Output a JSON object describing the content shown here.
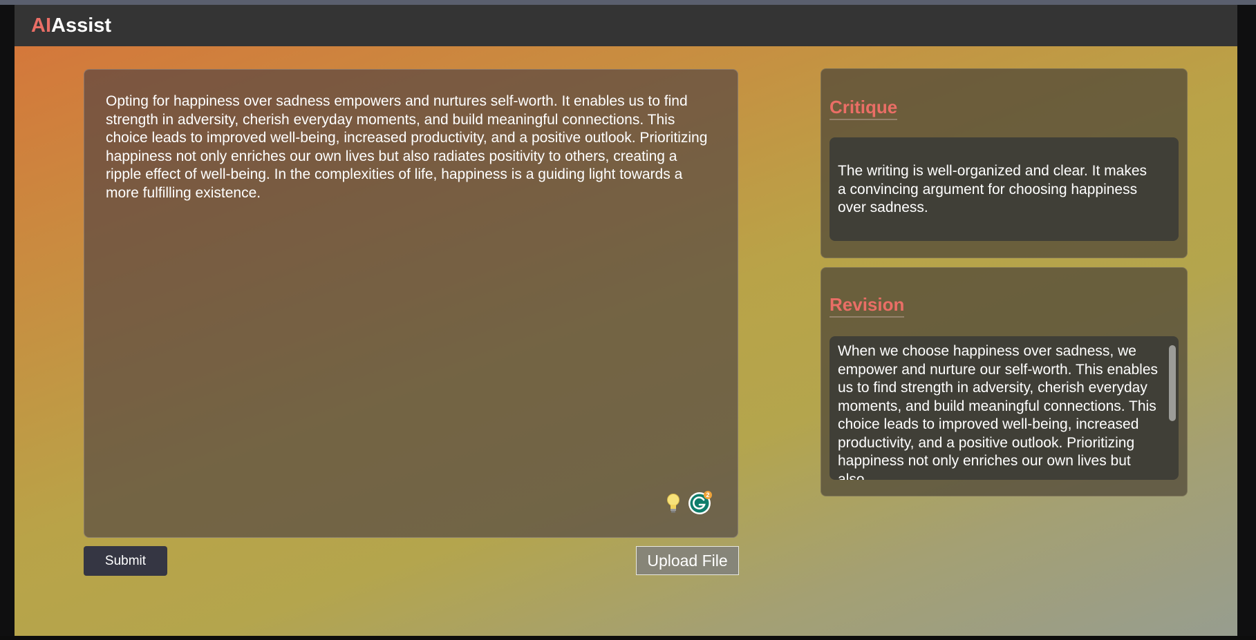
{
  "app": {
    "brand_prefix": "AI",
    "brand_suffix": "Assist",
    "colors": {
      "accent": "#ea6e66",
      "navbar": "#343434",
      "submit_button": "#353643"
    }
  },
  "editor": {
    "text": "Opting for happiness over sadness empowers and nurtures self-worth. It enables us to find strength in adversity, cherish everyday moments, and build meaningful connections. This choice leads to improved well-being, increased productivity, and a positive outlook. Prioritizing happiness not only enriches our own lives but also radiates positivity to others, creating a ripple effect of well-being. In the complexities of life, happiness is a guiding light towards a more fulfilling existence.",
    "icons": [
      "lightbulb-icon",
      "grammarly-icon"
    ],
    "grammarly_badge": "2"
  },
  "actions": {
    "submit_label": "Submit",
    "upload_label": "Upload File"
  },
  "critique": {
    "title": "Critique",
    "text": "The writing is well-organized and clear. It makes a convincing argument for choosing happiness over sadness."
  },
  "revision": {
    "title": "Revision",
    "text": "When we choose happiness over sadness, we empower and nurture our self-worth. This enables us to find strength in adversity, cherish everyday moments, and build meaningful connections. This choice leads to improved well-being, increased productivity, and a positive outlook. Prioritizing happiness not only enriches our own lives but also"
  }
}
